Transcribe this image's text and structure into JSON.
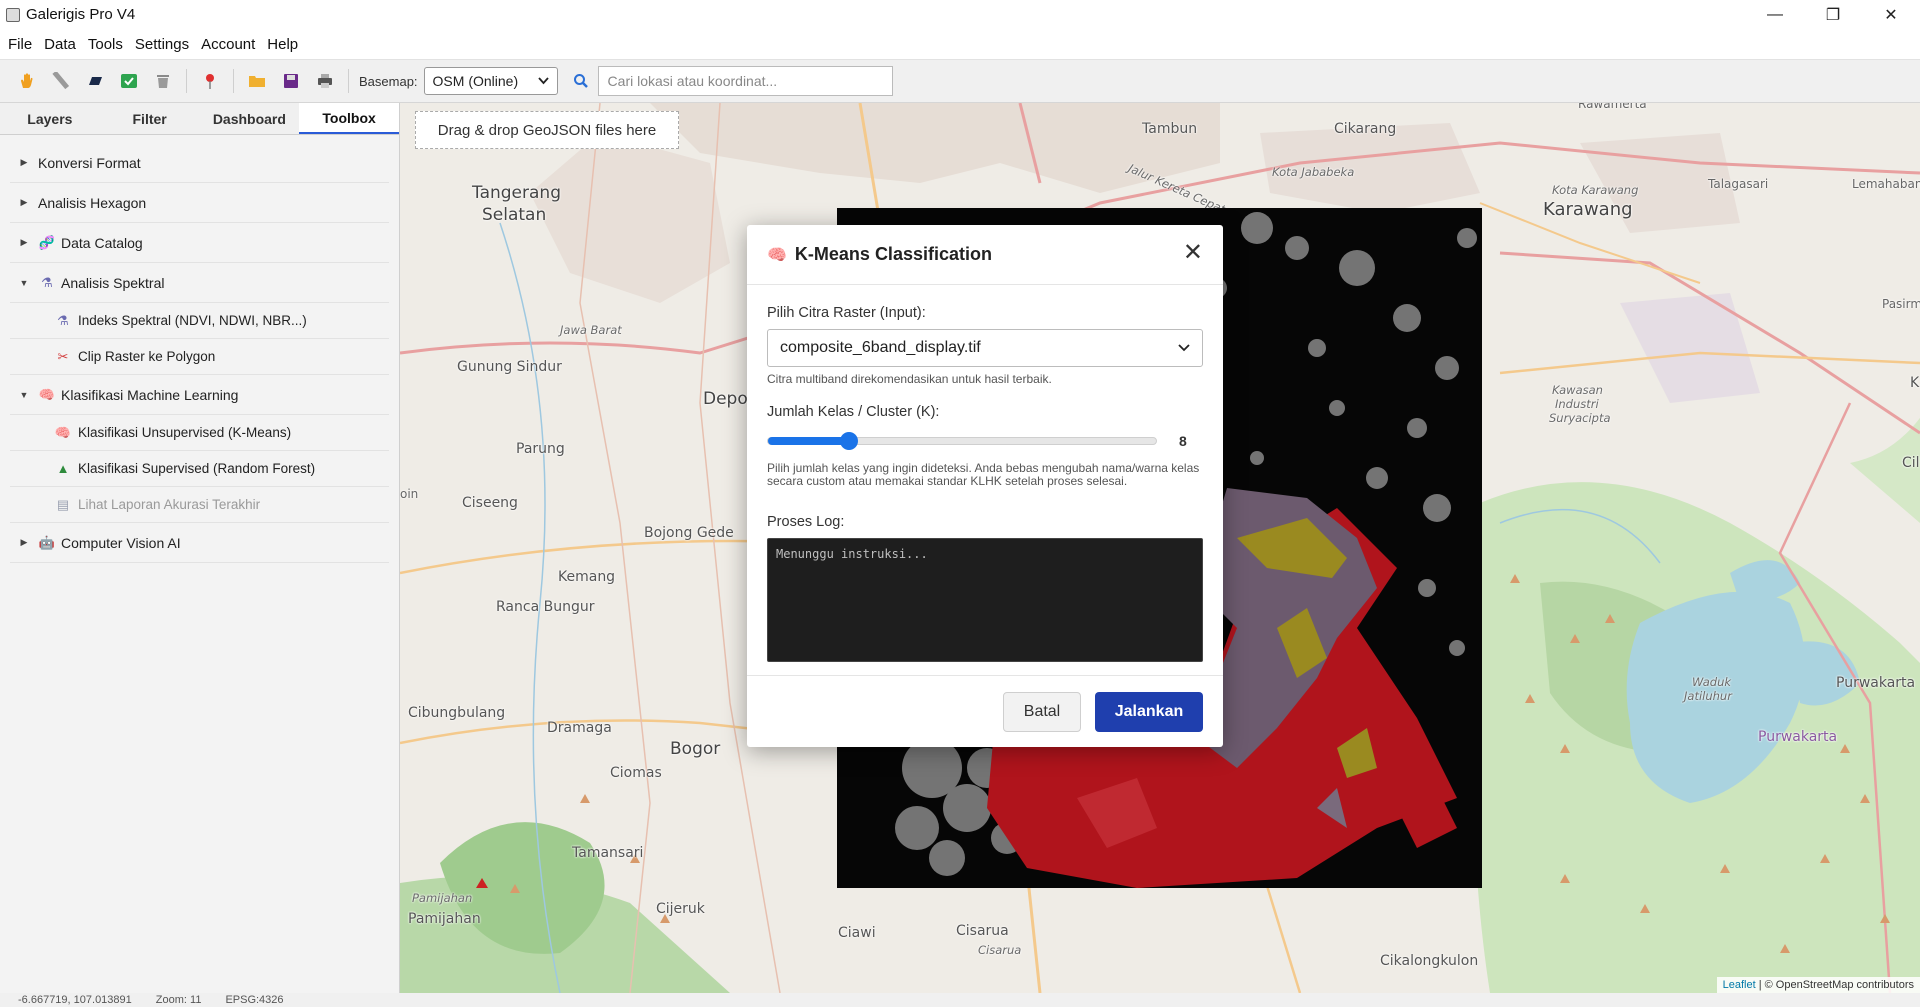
{
  "app": {
    "title": "Galerigis Pro V4",
    "window_controls": {
      "minimize": "—",
      "maximize": "❐",
      "close": "✕"
    }
  },
  "menu": [
    "File",
    "Data",
    "Tools",
    "Settings",
    "Account",
    "Help"
  ],
  "toolbar": {
    "tools": [
      {
        "name": "pan-tool",
        "icon": "hand-icon",
        "color": "#f0a020"
      },
      {
        "name": "measure-tool",
        "icon": "ruler-icon",
        "color": "#888888"
      },
      {
        "name": "draw-tool",
        "icon": "rectangle-icon",
        "color": "#1a2a4a"
      },
      {
        "name": "select-tool",
        "icon": "checkbox-icon",
        "color": "#2ea44f"
      },
      {
        "name": "delete-tool",
        "icon": "trash-icon",
        "color": "#8a8a8a"
      },
      {
        "name": "marker-tool",
        "icon": "pin-icon",
        "color": "#e03030"
      },
      {
        "name": "open-tool",
        "icon": "folder-icon",
        "color": "#f0b030"
      },
      {
        "name": "save-tool",
        "icon": "disk-icon",
        "color": "#6a2a8a"
      },
      {
        "name": "print-tool",
        "icon": "printer-icon",
        "color": "#555555"
      }
    ],
    "basemap_label": "Basemap:",
    "basemap_value": "OSM (Online)",
    "search_placeholder": "Cari lokasi atau koordinat..."
  },
  "sidebar": {
    "tabs": [
      "Layers",
      "Filter",
      "Dashboard",
      "Toolbox"
    ],
    "active_tab": "Toolbox",
    "tree": {
      "konversi": "Konversi Format",
      "hexagon": "Analisis Hexagon",
      "catalog": "Data Catalog",
      "spektral": "Analisis Spektral",
      "indeks": "Indeks Spektral (NDVI, NDWI, NBR...)",
      "clip": "Clip Raster ke Polygon",
      "ml": "Klasifikasi Machine Learning",
      "kmeans": "Klasifikasi Unsupervised (K-Means)",
      "rf": "Klasifikasi Supervised (Random Forest)",
      "laporan": "Lihat Laporan Akurasi Terakhir",
      "cv": "Computer Vision AI"
    }
  },
  "map": {
    "dropzone": "Drag & drop GeoJSON files here",
    "labels": {
      "tangerang": "Tangerang",
      "selatan": "Selatan",
      "tambun": "Tambun",
      "cikarang": "Cikarang",
      "kota_jababeka": "Kota Jababeka",
      "karawang": "Karawang",
      "kota_karawang": "Kota Karawang",
      "rawamerta": "Rawamerta",
      "talagasari": "Talagasari",
      "lemahabang": "Lemahabang",
      "pasirm": "Pasirm",
      "gunung_sindur": "Gunung Sindur",
      "depo": "Depo",
      "parung": "Parung",
      "ciseeng": "Ciseeng",
      "bojong_gede": "Bojong Gede",
      "kemang": "Kemang",
      "ranca_bungur": "Ranca Bungur",
      "cibungbulang": "Cibungbulang",
      "dramaga": "Dramaga",
      "bogor": "Bogor",
      "ciomas": "Ciomas",
      "tamansari": "Tamansari",
      "pamijahan": "Pamijahan",
      "pamijahan_it": "Pamijahan",
      "cijeruk": "Cijeruk",
      "ciawi": "Ciawi",
      "cisarua": "Cisarua",
      "cisarua_it": "Cisarua",
      "cikalongkulon": "Cikalongkulon",
      "purwakarta": "Purwakarta",
      "purwakarta2": "Purwakarta",
      "waduk": "Waduk",
      "jatiluhur": "Jatiluhur",
      "kawasan": "Kawasan",
      "industri": "Industri",
      "suryacipta": "Suryacipta",
      "cil": "Cil",
      "k": "K",
      "jalur_kereta": "Jalur Kereta Cepat Jakarta",
      "jawa_barat": "Jawa Barat",
      "oin": "oin"
    },
    "attribution_leaflet": "Leaflet",
    "attribution_rest": "| © OpenStreetMap contributors"
  },
  "status": {
    "coords": "-6.667719, 107.013891",
    "zoom": "Zoom: 11",
    "crs": "EPSG:4326"
  },
  "modal": {
    "title": "K-Means Classification",
    "input_label": "Pilih Citra Raster (Input):",
    "input_value": "composite_6band_display.tif",
    "input_hint": "Citra multiband direkomendasikan untuk hasil terbaik.",
    "k_label": "Jumlah Kelas / Cluster (K):",
    "k_value": "8",
    "k_fraction": 0.21,
    "k_hint": "Pilih jumlah kelas yang ingin dideteksi. Anda bebas mengubah nama/warna kelas secara custom atau memakai standar KLHK setelah proses selesai.",
    "log_label": "Proses Log:",
    "log_text": "Menunggu instruksi...",
    "cancel": "Batal",
    "run": "Jalankan"
  }
}
